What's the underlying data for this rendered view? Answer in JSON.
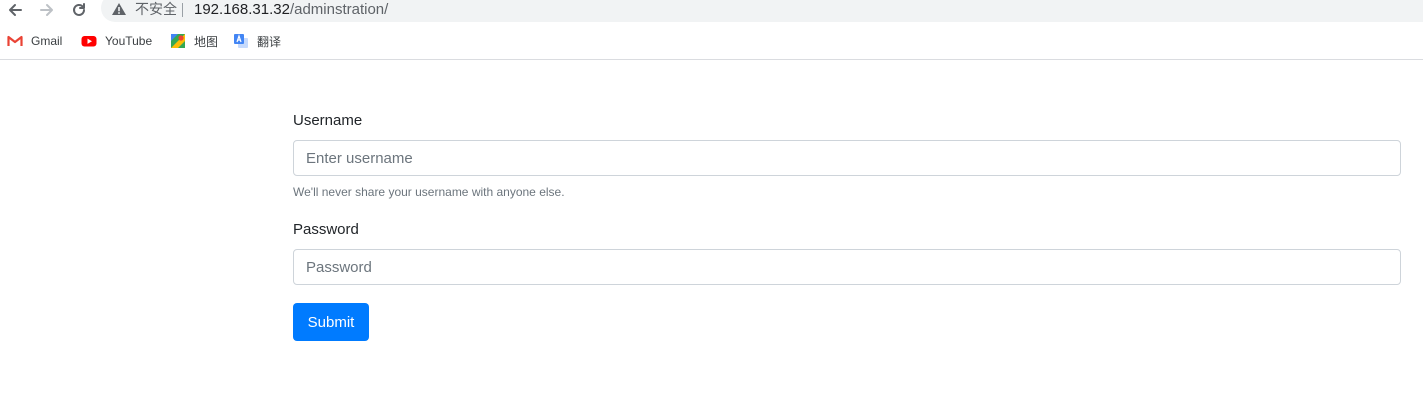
{
  "browser": {
    "security_label": "不安全",
    "url_host": "192.168.31.32",
    "url_path": "/adminstration/",
    "warning_color": "#5f6368"
  },
  "bookmarks": [
    {
      "label": "Gmail",
      "icon": "gmail-icon"
    },
    {
      "label": "YouTube",
      "icon": "youtube-icon"
    },
    {
      "label": "地图",
      "icon": "maps-icon"
    },
    {
      "label": "翻译",
      "icon": "translate-icon"
    }
  ],
  "form": {
    "username_label": "Username",
    "username_placeholder": "Enter username",
    "username_value": "",
    "username_help": "We'll never share your username with anyone else.",
    "password_label": "Password",
    "password_placeholder": "Password",
    "password_value": "",
    "submit_label": "Submit",
    "accent_color": "#007bff"
  }
}
